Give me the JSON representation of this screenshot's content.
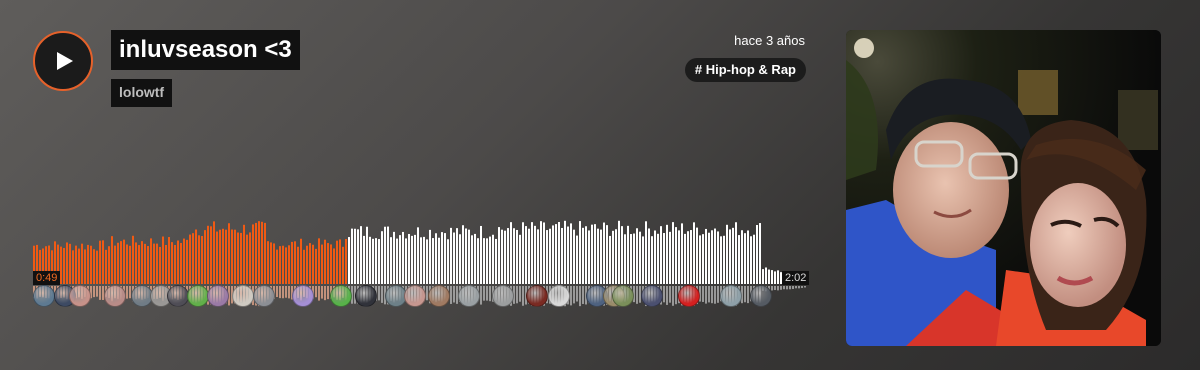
{
  "player": {
    "title": "inluvseason <3",
    "artist": "lolowtf",
    "posted": "hace 3 años",
    "tag": "# Hip-hop & Rap",
    "elapsed": "0:49",
    "duration": "2:02",
    "progress": 0.405,
    "colors": {
      "accent": "#f26b22",
      "played": "#f05a14",
      "unplayed": "#ffffff",
      "background": "#4c4a49"
    },
    "icons": {
      "play": "play-icon"
    }
  },
  "comments": [
    {
      "pos": 0.0,
      "color": "#5e7a92"
    },
    {
      "pos": 0.028,
      "color": "#3d4a63"
    },
    {
      "pos": 0.048,
      "color": "#c7928a"
    },
    {
      "pos": 0.095,
      "color": "#b98c88"
    },
    {
      "pos": 0.13,
      "color": "#707c86"
    },
    {
      "pos": 0.155,
      "color": "#9a9896"
    },
    {
      "pos": 0.178,
      "color": "#4f4d56"
    },
    {
      "pos": 0.205,
      "color": "#62b04a"
    },
    {
      "pos": 0.232,
      "color": "#9a7aa6"
    },
    {
      "pos": 0.265,
      "color": "#cfcac2"
    },
    {
      "pos": 0.292,
      "color": "#8c8f95"
    },
    {
      "pos": 0.345,
      "color": "#a58fd6"
    },
    {
      "pos": 0.395,
      "color": "#58b24a"
    },
    {
      "pos": 0.428,
      "color": "#30323a"
    },
    {
      "pos": 0.468,
      "color": "#6d8088"
    },
    {
      "pos": 0.493,
      "color": "#c79790"
    },
    {
      "pos": 0.525,
      "color": "#a07a62"
    },
    {
      "pos": 0.565,
      "color": "#9aa0a3"
    },
    {
      "pos": 0.61,
      "color": "#9c9e9f"
    },
    {
      "pos": 0.655,
      "color": "#7a2a22"
    },
    {
      "pos": 0.685,
      "color": "#d8d8d8"
    },
    {
      "pos": 0.735,
      "color": "#4e6280"
    },
    {
      "pos": 0.758,
      "color": "#9b8c6a"
    },
    {
      "pos": 0.77,
      "color": "#7a8f5a"
    },
    {
      "pos": 0.808,
      "color": "#4b5070"
    },
    {
      "pos": 0.858,
      "color": "#d42020"
    },
    {
      "pos": 0.914,
      "color": "#8ea0a8"
    },
    {
      "pos": 0.953,
      "color": "#555b63"
    }
  ]
}
